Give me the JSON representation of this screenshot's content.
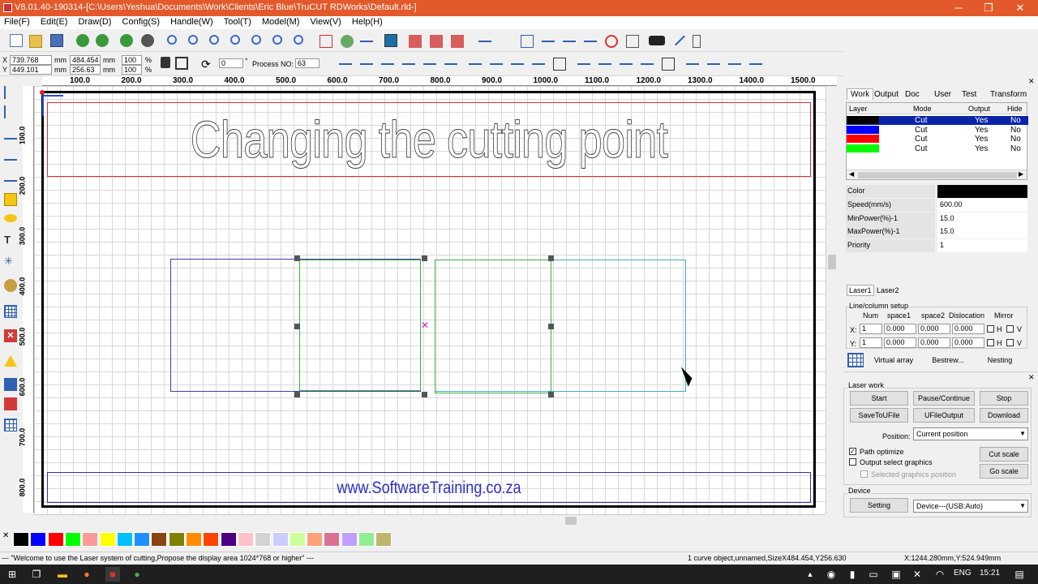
{
  "window": {
    "title": "V8.01.40-190314-[C:\\Users\\Yeshua\\Documents\\Work\\Clients\\Eric Blue\\TruCUT RDWorks\\Default.rld-]",
    "minimize": "─",
    "maximize": "❐",
    "close": "✕"
  },
  "menu": [
    "File(F)",
    "Edit(E)",
    "Draw(D)",
    "Config(S)",
    "Handle(W)",
    "Tool(T)",
    "Model(M)",
    "View(V)",
    "Help(H)"
  ],
  "coords": {
    "x_label": "X",
    "y_label": "Y",
    "x_pos": "739.768",
    "y_pos": "449.101",
    "pos_unit": "mm",
    "width": "484.454",
    "height": "256.63",
    "size_unit": "mm",
    "scale_x": "100",
    "scale_y": "100",
    "scale_unit": "%",
    "rotation": "0",
    "rotation_unit": "°",
    "process_label": "Process NO:",
    "process_no": "63"
  },
  "ruler_top": [
    "100.0",
    "200.0",
    "300.0",
    "400.0",
    "500.0",
    "600.0",
    "700.0",
    "800.0",
    "900.0",
    "1000.0",
    "1100.0",
    "1200.0",
    "1300.0",
    "1400.0",
    "1500.0"
  ],
  "ruler_left": [
    "100.0",
    "200.0",
    "300.0",
    "400.0",
    "500.0",
    "600.0",
    "700.0",
    "800.0"
  ],
  "canvas": {
    "headline": "Changing the cutting point",
    "website": "www.SoftwareTraining.co.za"
  },
  "panel_tabs": [
    "Work",
    "Output",
    "Doc",
    "User",
    "Test",
    "Transform"
  ],
  "layer_headers": [
    "Layer",
    "Mode",
    "Output",
    "Hide"
  ],
  "layers": [
    {
      "color": "#000000",
      "mode": "Cut",
      "output": "Yes",
      "hide": "No"
    },
    {
      "color": "#0000ff",
      "mode": "Cut",
      "output": "Yes",
      "hide": "No"
    },
    {
      "color": "#ff0000",
      "mode": "Cut",
      "output": "Yes",
      "hide": "No"
    },
    {
      "color": "#00ff00",
      "mode": "Cut",
      "output": "Yes",
      "hide": "No"
    }
  ],
  "props": [
    {
      "key": "Color",
      "value": ""
    },
    {
      "key": "Speed(mm/s)",
      "value": "600.00"
    },
    {
      "key": "MinPower(%)-1",
      "value": "15.0"
    },
    {
      "key": "MaxPower(%)-1",
      "value": "15.0"
    },
    {
      "key": "Priority",
      "value": "1"
    }
  ],
  "laser_tabs": [
    "Laser1",
    "Laser2"
  ],
  "line_column": {
    "title": "Line/column setup",
    "headers": [
      "Num",
      "space1",
      "space2",
      "Dislocation",
      "Mirror"
    ],
    "x_label": "X:",
    "y_label": "Y:",
    "x_vals": [
      "1",
      "0.000",
      "0.000",
      "0.000"
    ],
    "y_vals": [
      "1",
      "0.000",
      "0.000",
      "0.000"
    ],
    "mirror_h": "H",
    "mirror_v": "V",
    "virtual_array": "Virtual array",
    "bestrew": "Bestrew...",
    "nesting": "Nesting"
  },
  "laser_work": {
    "title": "Laser work",
    "start": "Start",
    "pause": "Pause/Continue",
    "stop": "Stop",
    "save_to_ufile": "SaveToUFile",
    "ufile_output": "UFileOutput",
    "download": "Download",
    "position_label": "Position:",
    "position_value": "Current position",
    "path_optimize": "Path optimize",
    "output_select": "Output select graphics",
    "selected_position": "Selected graphics position",
    "cut_scale": "Cut scale",
    "go_scale": "Go scale",
    "device_title": "Device",
    "setting": "Setting",
    "device_value": "Device---(USB:Auto)"
  },
  "palette": [
    "#000000",
    "#0000ff",
    "#ff0000",
    "#00ff00",
    "#ff9999",
    "#ffff00",
    "#00c0ff",
    "#1e90ff",
    "#8b4513",
    "#808000",
    "#ff8c00",
    "#ff4500",
    "#4b0082",
    "#ffc0cb",
    "#d3d3d3",
    "#ccccff",
    "#ccff99",
    "#ffa07a",
    "#db7093",
    "#c0a0ff",
    "#90ee90",
    "#bdb76b"
  ],
  "status": {
    "welcome": "--- \"Welcome to use the Laser system of cutting,Propose the display area 1024*768 or higher\" ---",
    "selection": "1 curve object,unnamed,SizeX484.454,Y256.630",
    "cursor": "X:1244.280mm,Y:524.949mm"
  },
  "taskbar": {
    "lang": "ENG",
    "time": "15:21"
  }
}
